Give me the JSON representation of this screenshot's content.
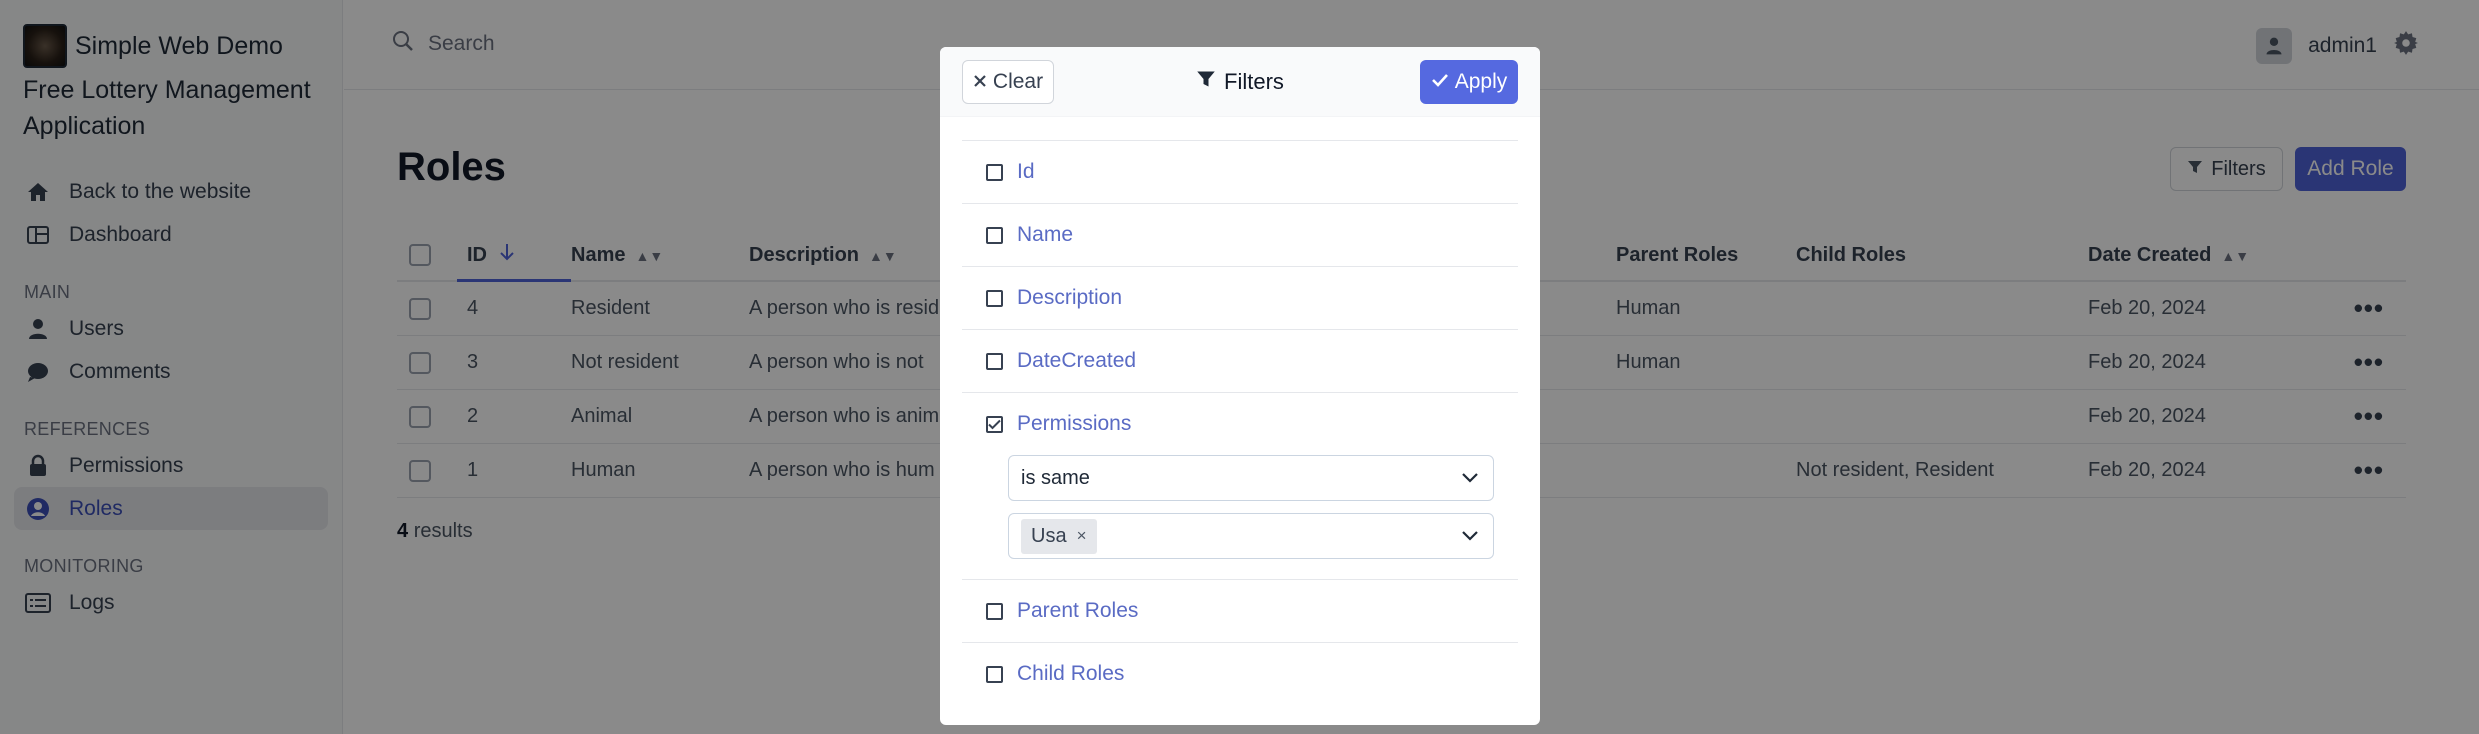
{
  "app": {
    "title": "Simple Web Demo",
    "subtitle": "Free Lottery Management Application"
  },
  "sidebar": {
    "items_top": [
      {
        "label": "Back to the website",
        "icon": "home-icon"
      },
      {
        "label": "Dashboard",
        "icon": "dashboard-icon"
      }
    ],
    "sections": [
      {
        "title": "MAIN",
        "items": [
          {
            "label": "Users",
            "icon": "user-icon"
          },
          {
            "label": "Comments",
            "icon": "comment-icon"
          }
        ]
      },
      {
        "title": "REFERENCES",
        "items": [
          {
            "label": "Permissions",
            "icon": "lock-icon"
          },
          {
            "label": "Roles",
            "icon": "user-circle-icon",
            "active": true
          }
        ]
      },
      {
        "title": "MONITORING",
        "items": [
          {
            "label": "Logs",
            "icon": "list-icon"
          }
        ]
      }
    ]
  },
  "topbar": {
    "search_placeholder": "Search",
    "username": "admin1"
  },
  "page": {
    "title": "Roles",
    "filters_button": "Filters",
    "add_button": "Add Role",
    "results_count": "4",
    "results_label": "results"
  },
  "table": {
    "headers": [
      "ID",
      "Name",
      "Description",
      "Parent Roles",
      "Child Roles",
      "Date Created"
    ],
    "rows": [
      {
        "id": "4",
        "name": "Resident",
        "description": "A person who is resid",
        "parent": "Human",
        "child": "",
        "date": "Feb 20, 2024"
      },
      {
        "id": "3",
        "name": "Not resident",
        "description": "A person who is not",
        "parent": "Human",
        "child": "",
        "date": "Feb 20, 2024"
      },
      {
        "id": "2",
        "name": "Animal",
        "description": "A person who is anim",
        "parent": "",
        "child": "",
        "date": "Feb 20, 2024"
      },
      {
        "id": "1",
        "name": "Human",
        "description": "A person who is hum",
        "parent": "",
        "child": "Not resident, Resident",
        "date": "Feb 20, 2024"
      }
    ]
  },
  "modal": {
    "clear_label": "Clear",
    "title": "Filters",
    "apply_label": "Apply",
    "filters": [
      {
        "label": "Id",
        "checked": false
      },
      {
        "label": "Name",
        "checked": false
      },
      {
        "label": "Description",
        "checked": false
      },
      {
        "label": "DateCreated",
        "checked": false
      },
      {
        "label": "Permissions",
        "checked": true
      },
      {
        "label": "Parent Roles",
        "checked": false
      },
      {
        "label": "Child Roles",
        "checked": false
      }
    ],
    "permissions_operator": "is same",
    "permissions_value": "Usa",
    "tag_remove": "×"
  },
  "colors": {
    "accent": "#4f62d8",
    "link": "#5a6bc4",
    "overlay": "rgba(0,0,0,0.46)"
  }
}
